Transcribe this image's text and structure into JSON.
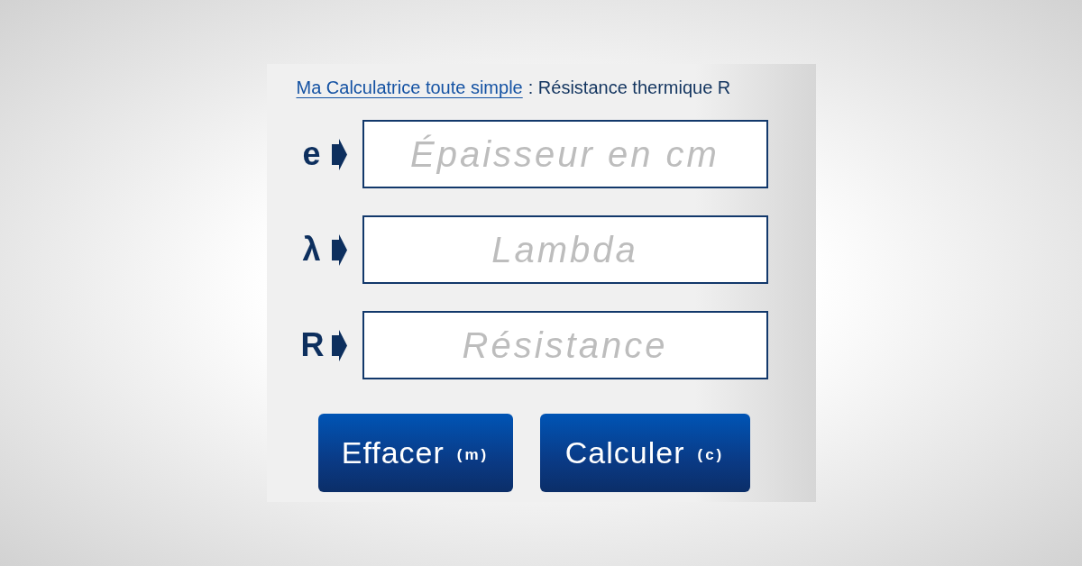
{
  "title": {
    "link": "Ma Calculatrice toute simple",
    "text": ": Résistance thermique R"
  },
  "fields": [
    {
      "symbol": "e",
      "placeholder": "Épaisseur en cm"
    },
    {
      "symbol": "λ",
      "placeholder": "Lambda"
    },
    {
      "symbol": "R",
      "placeholder": "Résistance"
    }
  ],
  "buttons": [
    {
      "label": "Effacer",
      "shortcut": "(m)"
    },
    {
      "label": "Calculer",
      "shortcut": "(c)"
    }
  ]
}
